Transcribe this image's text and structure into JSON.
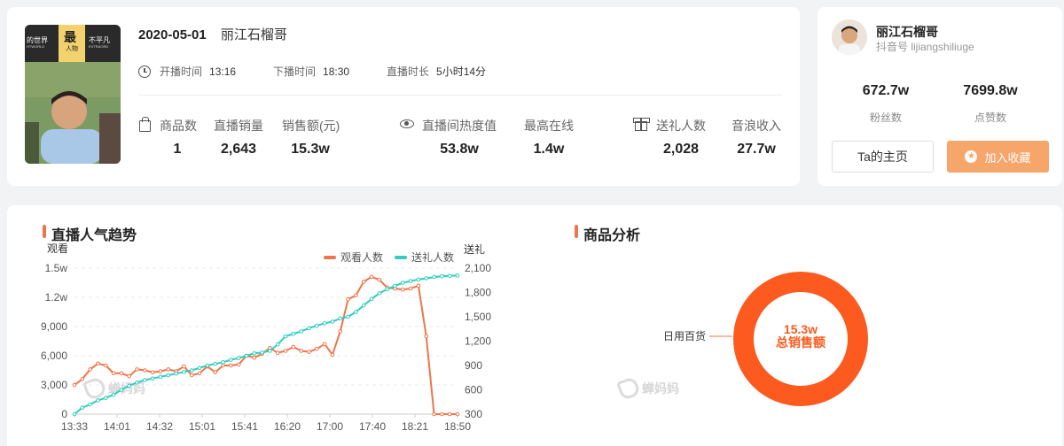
{
  "live": {
    "date": "2020-05-01",
    "anchor_name": "丽江石榴哥",
    "start_label": "开播时间",
    "start_time": "13:16",
    "end_label": "下播时间",
    "end_time": "18:30",
    "duration_label": "直播时长",
    "duration": "5小时14分",
    "cover_text": {
      "left": "的世界",
      "left_sub": "HTWORLD",
      "mid": "最",
      "mid_sub": "人物",
      "right": "不平凡",
      "right_sub": "EXTRAORD"
    },
    "stats": [
      {
        "label": "商品数",
        "value": "1"
      },
      {
        "label": "直播销量",
        "value": "2,643"
      },
      {
        "label": "销售额(元)",
        "value": "15.3w"
      },
      {
        "label": "直播间热度值",
        "value": "53.8w"
      },
      {
        "label": "最高在线",
        "value": "1.4w"
      },
      {
        "label": "送礼人数",
        "value": "2,028"
      },
      {
        "label": "音浪收入",
        "value": "27.7w"
      }
    ]
  },
  "host": {
    "name": "丽江石榴哥",
    "douyin_id": "抖音号 lijiangshiliuge",
    "fans_value": "672.7w",
    "fans_label": "粉丝数",
    "likes_value": "7699.8w",
    "likes_label": "点赞数",
    "home_button": "Ta的主页",
    "fav_button": "加入收藏"
  },
  "trend": {
    "title": "直播人气趋势",
    "left_axis_title": "观看",
    "right_axis_title": "送礼",
    "legend_viewers": "观看人数",
    "legend_gifts": "送礼人数",
    "watermark": "蝉妈妈"
  },
  "product": {
    "title": "商品分析",
    "category": "日用百货",
    "center_value": "15.3w",
    "center_label": "总销售额",
    "watermark": "蝉妈妈"
  },
  "colors": {
    "viewers": "#f0744a",
    "gifts": "#2ecdc0",
    "donut": "#fc5a1e",
    "accent": "#f6a56b"
  },
  "chart_data": [
    {
      "type": "line",
      "title": "",
      "x_tick_labels": [
        "13:33",
        "14:01",
        "14:32",
        "15:01",
        "15:41",
        "16:20",
        "17:00",
        "17:40",
        "18:21",
        "18:50"
      ],
      "y_left": {
        "title": "观看",
        "range": [
          0,
          15000
        ],
        "ticks": [
          "0",
          "3,000",
          "6,000",
          "9,000",
          "1.2w",
          "1.5w"
        ]
      },
      "y_right": {
        "title": "送礼",
        "range": [
          300,
          2100
        ],
        "ticks": [
          "300",
          "600",
          "900",
          "1,200",
          "1,500",
          "1,800",
          "2,100"
        ]
      },
      "grid": "horizontal dashed",
      "legend_position": "top-right",
      "series": [
        {
          "name": "观看人数",
          "axis": "left",
          "values": [
            3000,
            3600,
            4600,
            5200,
            5000,
            4200,
            4200,
            3900,
            4600,
            4500,
            4300,
            4400,
            4600,
            4400,
            4900,
            4000,
            4200,
            4900,
            4300,
            5000,
            5000,
            5100,
            6000,
            5800,
            6200,
            6800,
            6300,
            6500,
            6900,
            6500,
            6400,
            6700,
            7200,
            6100,
            8500,
            11800,
            12200,
            13600,
            14100,
            13800,
            13000,
            12900,
            12800,
            12900,
            13200,
            8000,
            0,
            0,
            0,
            0
          ]
        },
        {
          "name": "送礼人数",
          "axis": "right",
          "values": [
            300,
            380,
            420,
            470,
            500,
            540,
            600,
            650,
            690,
            720,
            740,
            760,
            780,
            800,
            820,
            840,
            870,
            900,
            920,
            940,
            970,
            990,
            1020,
            1050,
            1060,
            1080,
            1160,
            1260,
            1290,
            1320,
            1360,
            1390,
            1420,
            1440,
            1480,
            1500,
            1560,
            1640,
            1720,
            1790,
            1840,
            1880,
            1920,
            1940,
            1960,
            1975,
            1990,
            2000,
            2005,
            2008
          ]
        }
      ]
    },
    {
      "type": "pie",
      "title": "",
      "categories": [
        "日用百货"
      ],
      "values": [
        100
      ],
      "center_value": "15.3w",
      "center_label": "总销售额"
    }
  ]
}
